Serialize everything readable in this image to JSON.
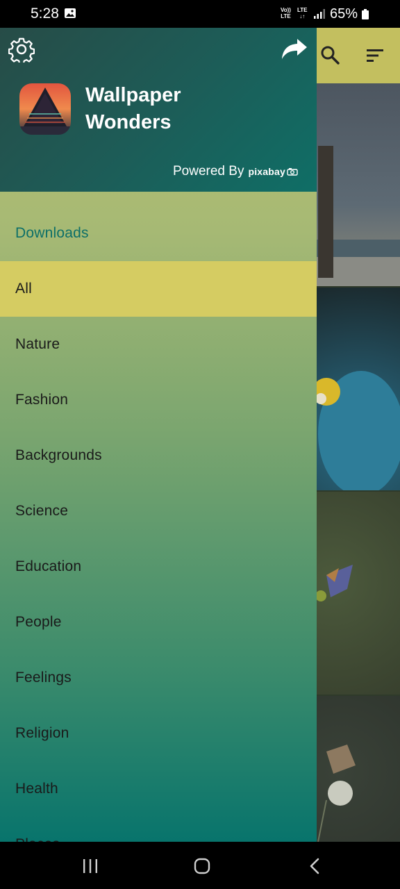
{
  "status_bar": {
    "time": "5:28",
    "volte_top": "Vo))",
    "volte_bottom": "LTE",
    "lte_top": "LTE",
    "lte_bottom": "↓↑",
    "battery": "65%",
    "icons": [
      "image-icon",
      "signal-icon",
      "battery-icon"
    ]
  },
  "background_app": {
    "icons": [
      "search-icon",
      "sort-icon"
    ],
    "toolbar_color": "#c3bf5f"
  },
  "drawer": {
    "title_line1": "Wallpaper",
    "title_line2": "Wonders",
    "powered_by": "Powered By",
    "pixabay": "pixabay",
    "icons": [
      "settings-icon",
      "share-icon",
      "app-logo"
    ],
    "menu": {
      "downloads": "Downloads",
      "items": [
        "All",
        "Nature",
        "Fashion",
        "Backgrounds",
        "Science",
        "Education",
        "People",
        "Feelings",
        "Religion",
        "Health",
        "Places"
      ],
      "selected": "All"
    },
    "colors": {
      "accent": "#0d6f68",
      "selected_bg": "#d5cc62"
    }
  },
  "nav_bar": {
    "icons": [
      "recents-icon",
      "home-icon",
      "back-icon"
    ]
  }
}
